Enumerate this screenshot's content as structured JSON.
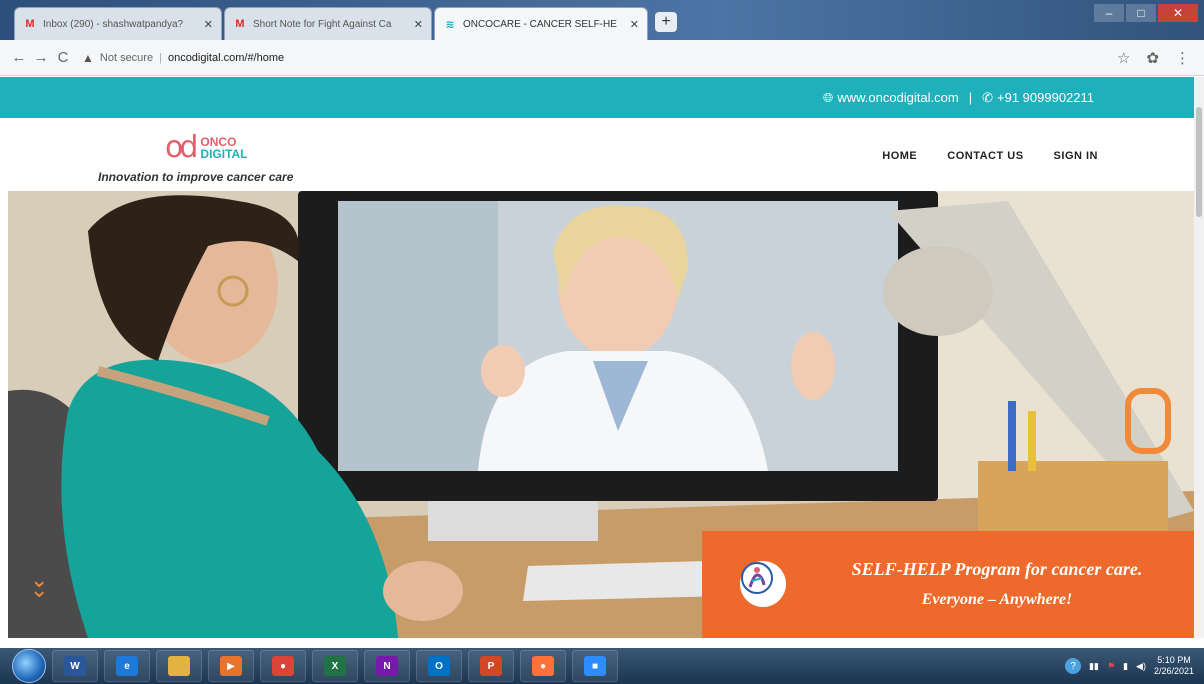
{
  "browser": {
    "tabs": [
      {
        "favicon": "gmail-icon",
        "title": "Inbox (290) - shashwatpandya?",
        "active": false
      },
      {
        "favicon": "gmail-icon",
        "title": "Short Note for Fight Against Ca",
        "active": false
      },
      {
        "favicon": "oncocare-icon",
        "title": "ONCOCARE - CANCER SELF-HE",
        "active": true
      }
    ],
    "security_label": "Not secure",
    "url": "oncodigital.com/#/home"
  },
  "site": {
    "contact_url": "www.oncodigital.com",
    "separator": "|",
    "phone": "+91 9099902211",
    "logo_top": "ONCO",
    "logo_bottom": "DIGITAL",
    "logo_mark": "od",
    "tagline": "Innovation to improve cancer care",
    "nav": {
      "home": "HOME",
      "contact": "CONTACT US",
      "signin": "SIGN IN"
    },
    "promo": {
      "line1": "SELF-HELP Program for cancer care.",
      "line2": "Everyone – Anywhere!"
    }
  },
  "taskbar": {
    "apps": [
      {
        "icon": "word-icon",
        "glyph": "W",
        "color": "#2b579a"
      },
      {
        "icon": "internet-explorer-icon",
        "glyph": "e",
        "color": "#1e7ad8"
      },
      {
        "icon": "file-explorer-icon",
        "glyph": "",
        "color": "#e3b341"
      },
      {
        "icon": "media-player-icon",
        "glyph": "▶",
        "color": "#e8742c"
      },
      {
        "icon": "chrome-icon",
        "glyph": "●",
        "color": "#db4437"
      },
      {
        "icon": "excel-icon",
        "glyph": "X",
        "color": "#217346"
      },
      {
        "icon": "onenote-icon",
        "glyph": "N",
        "color": "#7719aa"
      },
      {
        "icon": "outlook-icon",
        "glyph": "O",
        "color": "#0072c6"
      },
      {
        "icon": "powerpoint-icon",
        "glyph": "P",
        "color": "#d24726"
      },
      {
        "icon": "firefox-icon",
        "glyph": "●",
        "color": "#ff7139"
      },
      {
        "icon": "zoom-icon",
        "glyph": "■",
        "color": "#2d8cff"
      }
    ],
    "clock_time": "5:10 PM",
    "clock_date": "2/26/2021"
  }
}
